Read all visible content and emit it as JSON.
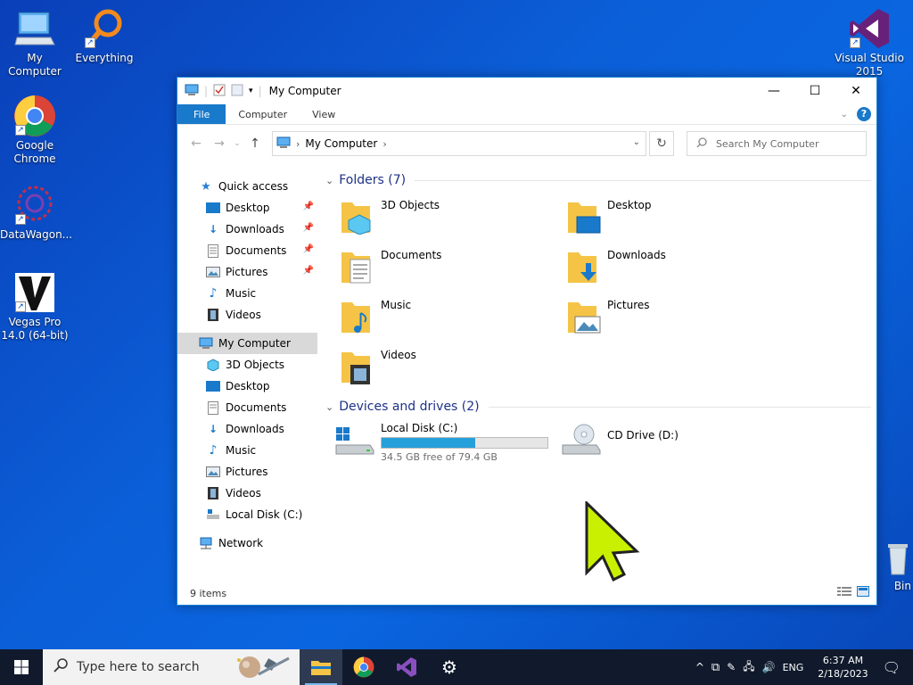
{
  "desktop": {
    "icons": [
      {
        "label": "My Computer",
        "icon": "computer-icon"
      },
      {
        "label": "Everything",
        "icon": "search-magnifier-icon"
      },
      {
        "label": "Google Chrome",
        "icon": "chrome-icon"
      },
      {
        "label": "DataWagon...",
        "icon": "datawagon-icon"
      },
      {
        "label": "Vegas Pro 14.0 (64-bit)",
        "icon": "vegas-icon"
      },
      {
        "label": "Visual Studio 2015",
        "icon": "visual-studio-icon"
      },
      {
        "label": "Bin",
        "icon": "recycle-bin-icon"
      }
    ]
  },
  "window": {
    "title": "My Computer",
    "ribbon_tabs": [
      "File",
      "Computer",
      "View"
    ],
    "help": "?",
    "address": {
      "crumb": "My Computer"
    },
    "search_placeholder": "Search My Computer",
    "sidebar": {
      "quick_access": "Quick access",
      "quick_items": [
        "Desktop",
        "Downloads",
        "Documents",
        "Pictures",
        "Music",
        "Videos"
      ],
      "this_pc": "My Computer",
      "pc_items": [
        "3D Objects",
        "Desktop",
        "Documents",
        "Downloads",
        "Music",
        "Pictures",
        "Videos",
        "Local Disk (C:)"
      ],
      "network": "Network"
    },
    "folders_header": "Folders (7)",
    "folders": [
      "3D Objects",
      "Desktop",
      "Documents",
      "Downloads",
      "Music",
      "Pictures",
      "Videos"
    ],
    "drives_header": "Devices and drives (2)",
    "drives": [
      {
        "name": "Local Disk (C:)",
        "free": "34.5 GB free of 79.4 GB",
        "used_fraction": 0.565
      },
      {
        "name": "CD Drive (D:)"
      }
    ],
    "status": "9 items"
  },
  "taskbar": {
    "search_placeholder": "Type here to search",
    "tray_lang": "ENG",
    "time": "6:37 AM",
    "date": "2/18/2023"
  },
  "colors": {
    "accent": "#1979ca",
    "drive_bar": "#26a0da",
    "folder": "#f5c446"
  }
}
